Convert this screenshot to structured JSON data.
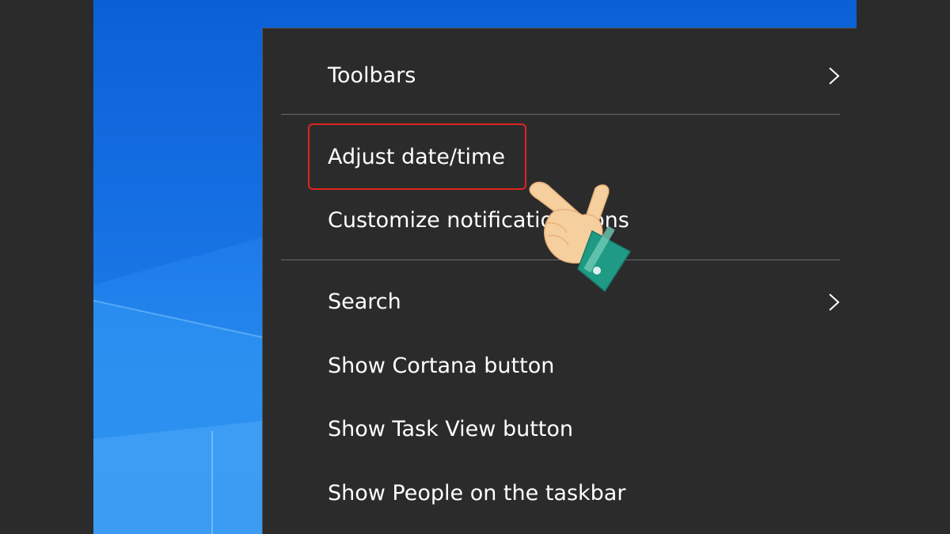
{
  "menu": {
    "items": [
      {
        "label": "Toolbars",
        "has_submenu": true
      },
      {
        "label": "Adjust date/time",
        "has_submenu": false,
        "highlighted": true
      },
      {
        "label": "Customize notification icons",
        "has_submenu": false
      },
      {
        "label": "Search",
        "has_submenu": true
      },
      {
        "label": "Show Cortana button",
        "has_submenu": false
      },
      {
        "label": "Show Task View button",
        "has_submenu": false
      },
      {
        "label": "Show People on the taskbar",
        "has_submenu": false
      }
    ]
  },
  "icons": {
    "submenu": "chevron-right-icon",
    "pointer": "pointing-hand-icon"
  },
  "colors": {
    "menu_background": "#2b2b2b",
    "menu_text": "#ffffff",
    "highlight_border": "#e0241f",
    "desktop_blue": "#1a78e8",
    "hand_cuff": "#1f9a84"
  }
}
